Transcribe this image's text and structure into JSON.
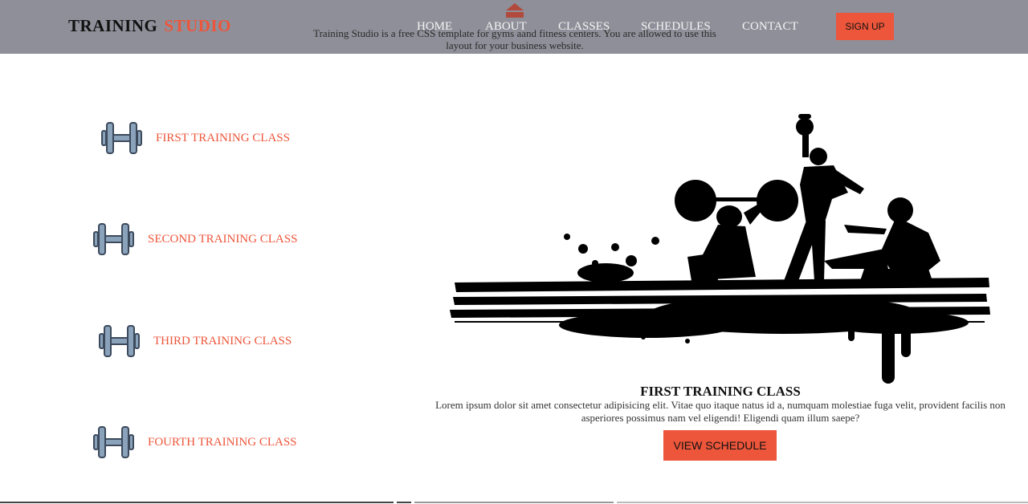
{
  "header": {
    "logo_main": "TRAINING",
    "logo_accent": "STUDIO",
    "tagline": "Training Studio is a free CSS template for gyms aand fitness centers. You are allowed to use this layout for your business website.",
    "nav": [
      "HOME",
      "ABOUT",
      "CLASSES",
      "SCHEDULES",
      "CONTACT"
    ],
    "signup_label": "SIGN UP"
  },
  "classes": [
    {
      "label": "FIRST TRAINING CLASS",
      "icon": "dumbbell-icon"
    },
    {
      "label": "SECOND TRAINING CLASS",
      "icon": "dumbbell-icon"
    },
    {
      "label": "THIRD TRAINING CLASS",
      "icon": "dumbbell-icon"
    },
    {
      "label": "FOURTH TRAINING CLASS",
      "icon": "dumbbell-icon"
    }
  ],
  "content": {
    "title": "FIRST TRAINING CLASS",
    "text": "Lorem ipsum dolor sit amet consectetur adipisicing elit. Vitae quo itaque natus id a, numquam molestiae fuga velit, provident facilis non asperiores possimus nam vel eligendi! Eligendi quam illum saepe?",
    "button_label": "VIEW SCHEDULE"
  },
  "colors": {
    "accent": "#ed563b",
    "header_bg": "#8f8f99",
    "icon_fill": "#8ba2bb",
    "icon_stroke": "#3c4a5c"
  }
}
